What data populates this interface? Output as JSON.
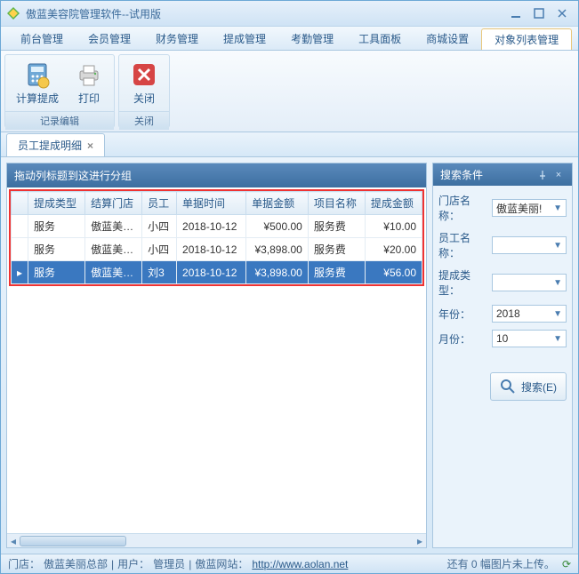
{
  "window": {
    "title": "傲蓝美容院管理软件--试用版"
  },
  "menu": {
    "items": [
      {
        "label": "前台管理"
      },
      {
        "label": "会员管理"
      },
      {
        "label": "财务管理"
      },
      {
        "label": "提成管理"
      },
      {
        "label": "考勤管理"
      },
      {
        "label": "工具面板"
      },
      {
        "label": "商城设置"
      },
      {
        "label": "对象列表管理",
        "active": true
      }
    ]
  },
  "ribbon": {
    "groups": [
      {
        "label": "记录编辑",
        "buttons": [
          {
            "key": "calc",
            "label": "计算提成"
          },
          {
            "key": "print",
            "label": "打印"
          }
        ]
      },
      {
        "label": "关闭",
        "buttons": [
          {
            "key": "close",
            "label": "关闭"
          }
        ]
      }
    ]
  },
  "tab": {
    "label": "员工提成明细"
  },
  "grid": {
    "group_hint": "拖动列标题到这进行分组",
    "columns": [
      "提成类型",
      "结算门店",
      "员工",
      "单据时间",
      "单据金额",
      "项目名称",
      "提成金额"
    ],
    "rows": [
      {
        "t": "服务",
        "s": "傲蓝美…",
        "e": "小四",
        "d": "2018-10-12",
        "a": "¥500.00",
        "p": "服务费",
        "c": "¥10.00"
      },
      {
        "t": "服务",
        "s": "傲蓝美…",
        "e": "小四",
        "d": "2018-10-12",
        "a": "¥3,898.00",
        "p": "服务费",
        "c": "¥20.00"
      },
      {
        "t": "服务",
        "s": "傲蓝美…",
        "e": "刘3",
        "d": "2018-10-12",
        "a": "¥3,898.00",
        "p": "服务费",
        "c": "¥56.00",
        "selected": true,
        "current": true
      }
    ]
  },
  "search": {
    "title": "搜索条件",
    "fields": {
      "store": {
        "label": "门店名称：",
        "value": "傲蓝美丽!"
      },
      "employee": {
        "label": "员工名称：",
        "value": ""
      },
      "type": {
        "label": "提成类型：",
        "value": ""
      },
      "year": {
        "label": "年份：",
        "value": "2018"
      },
      "month": {
        "label": "月份：",
        "value": "10"
      }
    },
    "button": "搜索(E)"
  },
  "status": {
    "store_label": "门店：",
    "store": "傲蓝美丽总部",
    "user_label": "用户：",
    "user": "管理员",
    "site_label": "傲蓝网站：",
    "url": "http://www.aolan.net",
    "right": "还有 0 幅图片未上传。"
  }
}
